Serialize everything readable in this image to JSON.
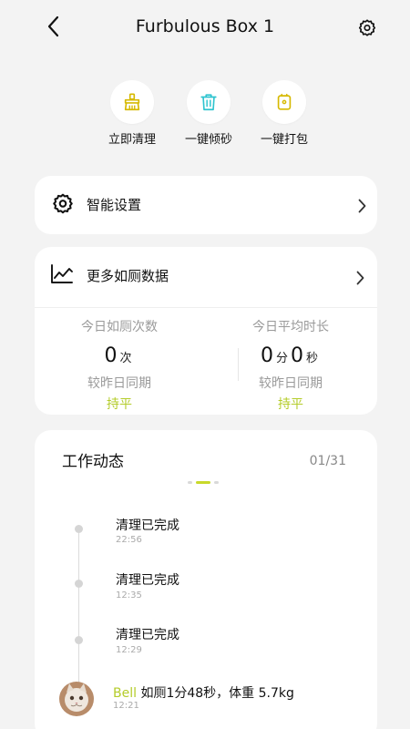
{
  "header": {
    "title": "Furbulous Box 1"
  },
  "quick_actions": [
    {
      "label": "立即清理",
      "icon": "broom-icon"
    },
    {
      "label": "一键倾砂",
      "icon": "trash-icon"
    },
    {
      "label": "一键打包",
      "icon": "package-icon"
    }
  ],
  "smart_settings": {
    "label": "智能设置"
  },
  "data_card": {
    "label": "更多如厕数据",
    "left": {
      "title": "今日如厕次数",
      "value": "0",
      "unit": "次",
      "compare": "较昨日同期",
      "trend": "持平"
    },
    "right": {
      "title": "今日平均时长",
      "minutes": "0",
      "minutes_unit": "分",
      "seconds": "0",
      "seconds_unit": "秒",
      "compare": "较昨日同期",
      "trend": "持平"
    }
  },
  "activity": {
    "title": "工作动态",
    "page": "01/31",
    "items": [
      {
        "title": "清理已完成",
        "time": "22:56"
      },
      {
        "title": "清理已完成",
        "time": "12:35"
      },
      {
        "title": "清理已完成",
        "time": "12:29"
      }
    ],
    "cat_event": {
      "name": "Bell",
      "detail": " 如厕1分48秒，体重 5.7kg",
      "time": "12:21"
    }
  },
  "colors": {
    "accent": "#c8d92a",
    "background": "#f3f3f3",
    "card": "#ffffff",
    "icon_yellow": "#d6b900",
    "icon_cyan": "#2ec4cf"
  }
}
